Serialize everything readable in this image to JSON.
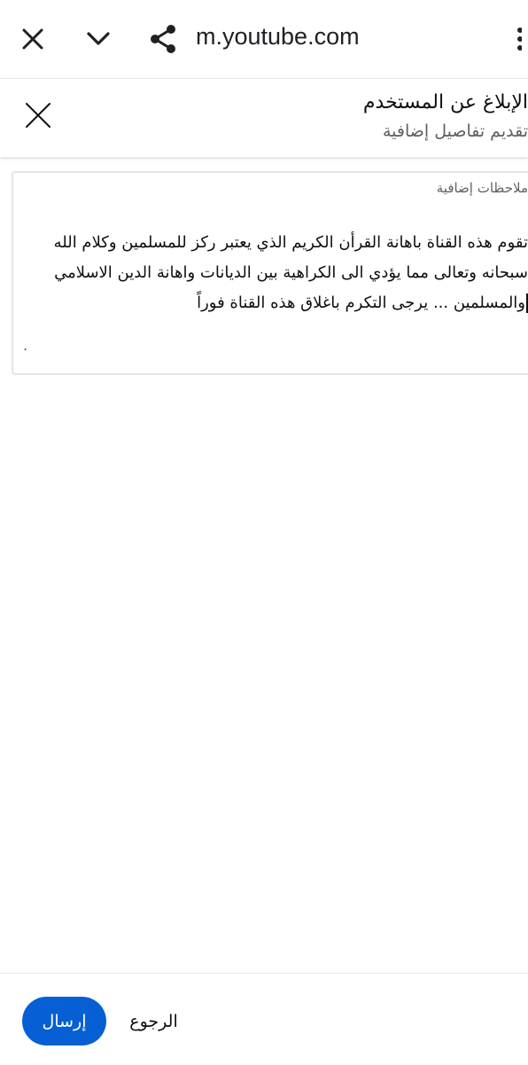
{
  "browser": {
    "url": "m.youtube.com",
    "icons": {
      "close": "close-icon",
      "chevron": "chevron-down-icon",
      "share": "share-icon",
      "menu": "more-vert-icon"
    }
  },
  "dialog": {
    "title": "الإبلاغ عن المستخدم",
    "subtitle": "تقديم تفاصيل إضافية",
    "close_icon": "close-icon"
  },
  "notes": {
    "label": "ملاحظات إضافية",
    "lines": [
      "تقوم هذه القناة باهانة القرأن الكريم الذي يعتبر ركز للمسلمين وكلام الله",
      "سبحانه وتعالى مما يؤدي الى الكراهية بين الديانات واهانة الدين الاسلامي",
      "والمسلمين ... يرجى التكرم باغلاق هذه القناة فوراً"
    ]
  },
  "footer": {
    "send_label": "إرسال",
    "back_label": "الرجوع"
  },
  "colors": {
    "accent": "#065fd4",
    "text": "#0f0f0f",
    "secondary_text": "#606060",
    "border": "#e4e4e4"
  }
}
